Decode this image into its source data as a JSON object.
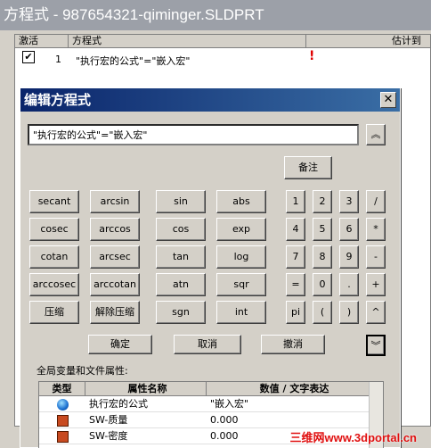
{
  "window": {
    "title": "方程式 - 987654321-qiminger.SLDPRT"
  },
  "equations_table": {
    "headers": [
      "激活",
      "方程式",
      "估计到"
    ],
    "rows": [
      {
        "checked": "✔",
        "index": "1",
        "formula": "\"执行宏的公式\"=\"嵌入宏\"",
        "warning": "!"
      }
    ]
  },
  "dialog": {
    "title": "编辑方程式",
    "close": "✕",
    "expression": "\"执行宏的公式\"=\"嵌入宏\"",
    "collapse": "︽",
    "note_button": "备注",
    "func_rows": [
      [
        "secant",
        "arcsin",
        "sin",
        "abs"
      ],
      [
        "cosec",
        "arccos",
        "cos",
        "exp"
      ],
      [
        "cotan",
        "arcsec",
        "tan",
        "log"
      ],
      [
        "arccosec",
        "arccotan",
        "atn",
        "sqr"
      ],
      [
        "压缩",
        "解除压缩",
        "sgn",
        "int"
      ]
    ],
    "num_rows": [
      [
        "1",
        "2",
        "3",
        "/"
      ],
      [
        "4",
        "5",
        "6",
        "*"
      ],
      [
        "7",
        "8",
        "9",
        "-"
      ],
      [
        "=",
        "0",
        ".",
        "+"
      ],
      [
        "pi",
        "(",
        ")",
        "^"
      ]
    ],
    "ok": "确定",
    "cancel": "取消",
    "undo": "撤消",
    "expand": "︾",
    "globals_label": "全局变量和文件属性:",
    "globals_headers": [
      "类型",
      "属性名称",
      "数值 / 文字表达"
    ],
    "globals_rows": [
      {
        "icon": "globe-icon",
        "name": "执行宏的公式",
        "value": "\"嵌入宏\""
      },
      {
        "icon": "property-icon",
        "name": "SW-质量",
        "value": "0.000"
      },
      {
        "icon": "property-icon",
        "name": "SW-密度",
        "value": "0.000"
      }
    ]
  },
  "watermark": "三维网www.3dportal.cn"
}
